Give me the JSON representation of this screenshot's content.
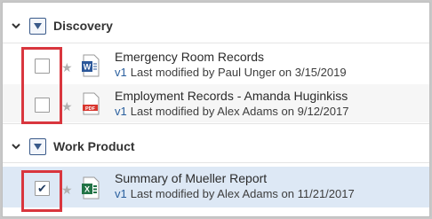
{
  "groups": [
    {
      "name": "Discovery",
      "documents": [
        {
          "title": "Emergency Room Records",
          "version": "v1",
          "modified": "Last modified by Paul Unger on 3/15/2019",
          "file_type": "word",
          "checked": false
        },
        {
          "title": "Employment Records - Amanda Huginkiss",
          "version": "v1",
          "modified": "Last modified by Alex Adams on 9/12/2017",
          "file_type": "pdf",
          "checked": false
        }
      ]
    },
    {
      "name": "Work Product",
      "documents": [
        {
          "title": "Summary of Mueller Report",
          "version": "v1",
          "modified": "Last modified by Alex Adams on 11/21/2017",
          "file_type": "excel",
          "checked": true
        }
      ]
    }
  ],
  "icons": {
    "word_letter": "W",
    "pdf_label": "PDF",
    "excel_letter": "X",
    "star": "★",
    "check": "✔"
  },
  "colors": {
    "callout": "#d9363e",
    "selected_row": "#dde8f5",
    "version_link": "#2a5f9e",
    "word_blue": "#2b579a",
    "pdf_red": "#d9362e",
    "excel_green": "#217346"
  }
}
